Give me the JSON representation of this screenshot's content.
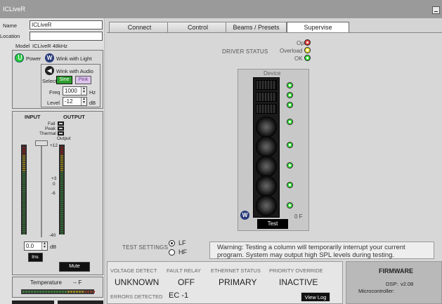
{
  "window": {
    "title": "ICLiveR"
  },
  "device": {
    "name_label": "Name",
    "name_value": "ICLiveR",
    "location_label": "Location",
    "location_value": "",
    "model_label": "Model",
    "model_value": "ICLiveR 48kHz"
  },
  "controls": {
    "power_label": "Power",
    "wink_light_label": "Wink with Light",
    "wink_audio_label": "Wink with Audio",
    "select_label": "Select",
    "sine_label": "Sine",
    "pink_label": "Pink",
    "freq_label": "Freq",
    "freq_value": "1000",
    "freq_unit": "Hz",
    "level_label": "Level",
    "level_value": "-12",
    "level_unit": "dB"
  },
  "io": {
    "input_label": "INPUT",
    "output_label": "OUTPUT",
    "fail_label": "Fail",
    "peak_label": "Peak",
    "thermal_label": "Thermal",
    "output_small_label": "Output",
    "scale": [
      "+12",
      "+3",
      "0",
      "-6",
      "-40"
    ],
    "gain_value": "0.0",
    "gain_unit": "dB",
    "inv_label": "Inv.",
    "mute_label": "Mute",
    "temperature_label": "Temperature",
    "temperature_value": "-- F"
  },
  "tabs": [
    "Connect",
    "Control",
    "Beams / Presets",
    "Supervise"
  ],
  "active_tab": "Supervise",
  "supervise": {
    "driver_status_label": "DRIVER STATUS",
    "legend_open": "Open",
    "legend_overload": "Overload",
    "legend_ok": "OK",
    "device_label": "Device",
    "temp_readout": "0 F",
    "test_button": "Test",
    "test_settings_label": "TEST SETTINGS",
    "radio_lf": "LF",
    "radio_hf": "HF",
    "warning": "Warning: Testing a column will temporarily interrupt your current program. System may output high SPL levels during testing."
  },
  "status": {
    "voltage_detect_label": "VOLTAGE DETECT",
    "voltage_detect_value": "UNKNOWN",
    "fault_relay_label": "FAULT RELAY",
    "fault_relay_value": "OFF",
    "ethernet_status_label": "ETHERNET STATUS",
    "ethernet_status_value": "PRIMARY",
    "priority_override_label": "PRIORITY OVERRIDE",
    "priority_override_value": "INACTIVE",
    "errors_detected_label": "ERRORS DETECTED",
    "errors_detected_value": "EC -1",
    "view_log_label": "View Log"
  },
  "firmware": {
    "title": "FIRMWARE",
    "dsp_label": "DSP:",
    "dsp_value": "v2.08",
    "micro_label": "Microcontroller:",
    "micro_value": ""
  },
  "colors": {
    "led_open": "#e53935",
    "led_overload": "#f3e23a",
    "led_ok": "#3ddc3d",
    "accent": "#2e9e2e"
  }
}
